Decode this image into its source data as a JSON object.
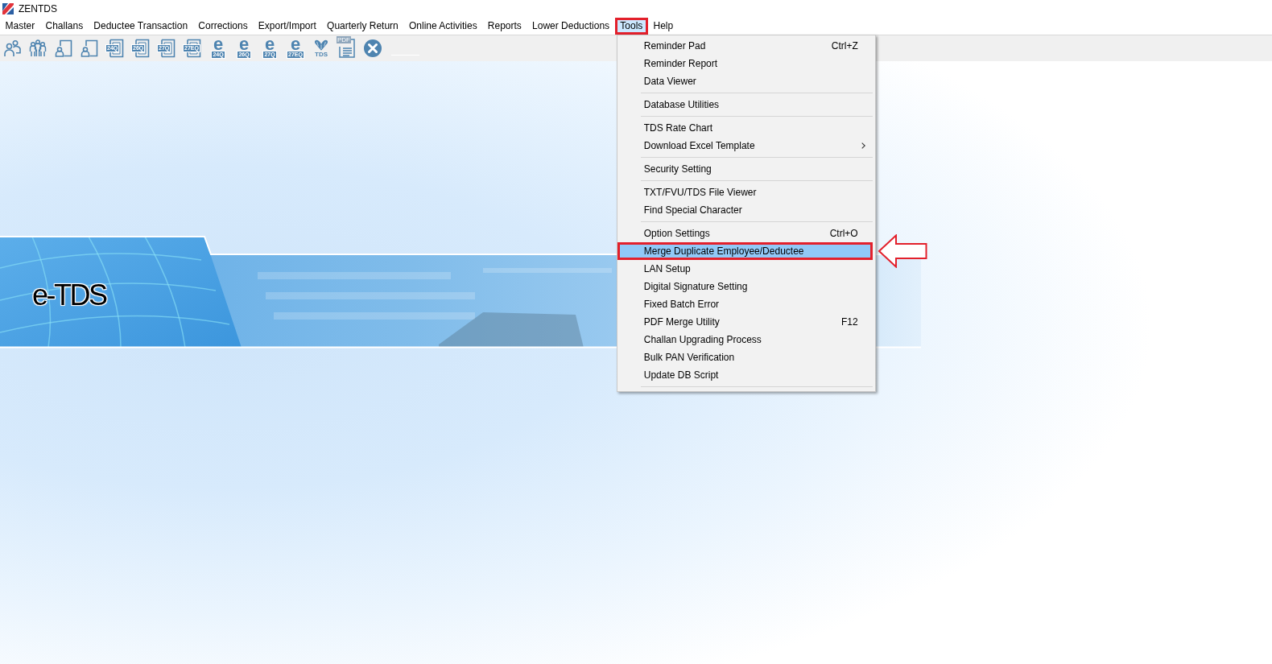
{
  "window": {
    "title": "ZENTDS"
  },
  "menu_bar": {
    "items": [
      {
        "label": "Master",
        "selected": false,
        "annotated": false
      },
      {
        "label": "Challans",
        "selected": false,
        "annotated": false
      },
      {
        "label": "Deductee Transaction",
        "selected": false,
        "annotated": false
      },
      {
        "label": "Corrections",
        "selected": false,
        "annotated": false
      },
      {
        "label": "Export/Import",
        "selected": false,
        "annotated": false
      },
      {
        "label": "Quarterly Return",
        "selected": false,
        "annotated": false
      },
      {
        "label": "Online Activities",
        "selected": false,
        "annotated": false
      },
      {
        "label": "Reports",
        "selected": false,
        "annotated": false
      },
      {
        "label": "Lower Deductions",
        "selected": false,
        "annotated": false
      },
      {
        "label": "Tools",
        "selected": true,
        "annotated": true
      },
      {
        "label": "Help",
        "selected": false,
        "annotated": false
      }
    ]
  },
  "toolbar": {
    "buttons": [
      {
        "kind": "people"
      },
      {
        "kind": "group"
      },
      {
        "kind": "contact"
      },
      {
        "kind": "contact"
      },
      {
        "kind": "form",
        "label": "24Q"
      },
      {
        "kind": "form",
        "label": "26Q"
      },
      {
        "kind": "form",
        "label": "27Q"
      },
      {
        "kind": "form",
        "label": "27EQ"
      },
      {
        "kind": "eform",
        "letter": "e",
        "label": "24Q"
      },
      {
        "kind": "eform",
        "letter": "e",
        "label": "26Q"
      },
      {
        "kind": "eform",
        "letter": "e",
        "label": "27Q"
      },
      {
        "kind": "eform",
        "letter": "e",
        "label": "27EQ"
      },
      {
        "kind": "emblem",
        "label": "TDS"
      },
      {
        "kind": "document",
        "label": "PDF"
      },
      {
        "kind": "close"
      }
    ]
  },
  "tools_menu": {
    "items": [
      {
        "kind": "item",
        "label": "Reminder Pad",
        "shortcut": "Ctrl+Z",
        "submenu": false,
        "selected": false,
        "annotated": false,
        "arrow": false
      },
      {
        "kind": "item",
        "label": "Reminder Report",
        "submenu": false,
        "selected": false,
        "annotated": false,
        "arrow": false
      },
      {
        "kind": "item",
        "label": "Data Viewer",
        "submenu": false,
        "selected": false,
        "annotated": false,
        "arrow": false
      },
      {
        "kind": "separator"
      },
      {
        "kind": "item",
        "label": "Database Utilities",
        "submenu": false,
        "selected": false,
        "annotated": false,
        "arrow": false
      },
      {
        "kind": "separator"
      },
      {
        "kind": "item",
        "label": "TDS Rate Chart",
        "submenu": false,
        "selected": false,
        "annotated": false,
        "arrow": false
      },
      {
        "kind": "item",
        "label": "Download Excel Template",
        "submenu": true,
        "selected": false,
        "annotated": false,
        "arrow": false
      },
      {
        "kind": "separator"
      },
      {
        "kind": "item",
        "label": "Security Setting",
        "submenu": false,
        "selected": false,
        "annotated": false,
        "arrow": false
      },
      {
        "kind": "separator"
      },
      {
        "kind": "item",
        "label": "TXT/FVU/TDS File Viewer",
        "submenu": false,
        "selected": false,
        "annotated": false,
        "arrow": false
      },
      {
        "kind": "item",
        "label": "Find Special Character",
        "submenu": false,
        "selected": false,
        "annotated": false,
        "arrow": false
      },
      {
        "kind": "separator"
      },
      {
        "kind": "item",
        "label": "Option Settings",
        "shortcut": "Ctrl+O",
        "submenu": false,
        "selected": false,
        "annotated": false,
        "arrow": false
      },
      {
        "kind": "item",
        "label": "Merge Duplicate Employee/Deductee",
        "submenu": false,
        "selected": true,
        "annotated": true,
        "arrow": true
      },
      {
        "kind": "item",
        "label": "LAN Setup",
        "submenu": false,
        "selected": false,
        "annotated": false,
        "arrow": false
      },
      {
        "kind": "item",
        "label": "Digital Signature Setting",
        "submenu": false,
        "selected": false,
        "annotated": false,
        "arrow": false
      },
      {
        "kind": "item",
        "label": "Fixed Batch Error",
        "submenu": false,
        "selected": false,
        "annotated": false,
        "arrow": false
      },
      {
        "kind": "item",
        "label": "PDF Merge Utility",
        "shortcut": "F12",
        "submenu": false,
        "selected": false,
        "annotated": false,
        "arrow": false
      },
      {
        "kind": "item",
        "label": "Challan Upgrading Process",
        "submenu": false,
        "selected": false,
        "annotated": false,
        "arrow": false
      },
      {
        "kind": "item",
        "label": "Bulk PAN Verification",
        "submenu": false,
        "selected": false,
        "annotated": false,
        "arrow": false
      },
      {
        "kind": "item",
        "label": "Update DB Script",
        "submenu": false,
        "selected": false,
        "annotated": false,
        "arrow": false
      },
      {
        "kind": "separator"
      }
    ]
  },
  "banner": {
    "title": "e-TDS"
  }
}
